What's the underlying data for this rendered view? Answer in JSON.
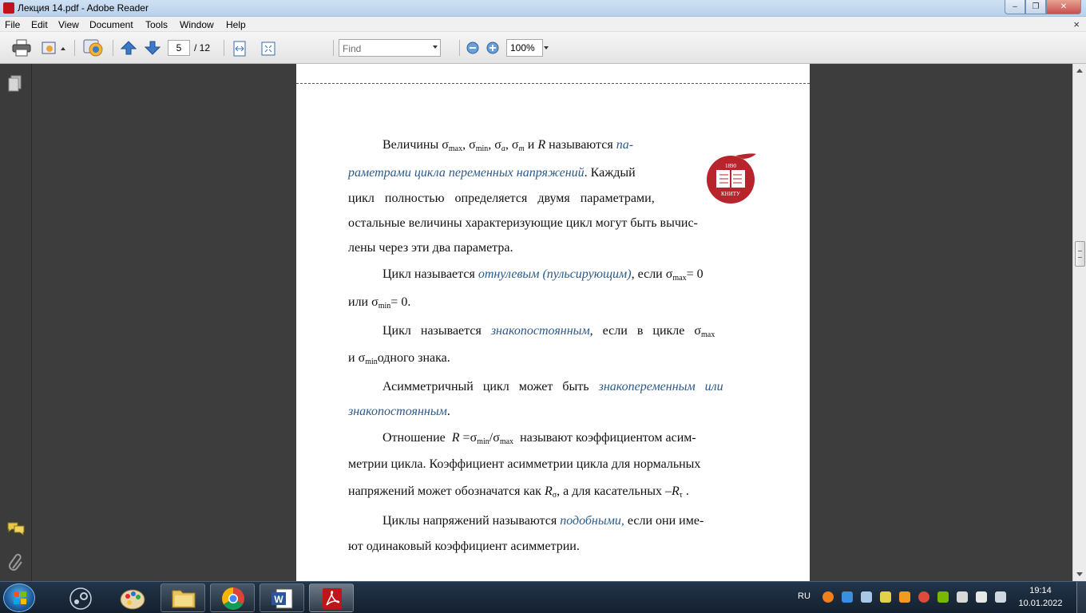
{
  "window": {
    "title": "Лекция 14.pdf - Adobe Reader",
    "minimize": "–",
    "maximize": "❐",
    "close": "✕"
  },
  "menu": {
    "items": [
      "File",
      "Edit",
      "View",
      "Document",
      "Tools",
      "Window",
      "Help"
    ],
    "close_doc": "×"
  },
  "toolbar": {
    "page_current": "5",
    "page_total": "/ 12",
    "find_placeholder": "Find",
    "zoom": "100%"
  },
  "document": {
    "p1": {
      "l1_pre": "Величины",
      "l1_and": "и",
      "l1_R": "R",
      "l1_mid": "называются",
      "l1_term": "па-",
      "l2_term": "раметрами цикла переменных напряжений",
      "l2_post": ". Каждый",
      "l3": "цикл полностью определяется двумя параметрами,",
      "l4": "остальные величины характеризующие цикл могут быть вычис-",
      "l5": "лены через эти два параметра."
    },
    "p2": {
      "pre": "Цикл называется",
      "term": "отнулевым (пульсирующим)",
      "post": ", если",
      "eq": "= 0",
      "l2_pre": "или",
      "l2_eq": "= 0."
    },
    "p3": {
      "pre": "Цикл называется",
      "term": "знакопостоянным",
      "post": ", если в цикле",
      "l2_pre": "и",
      "l2_post": "одного знака."
    },
    "p4": {
      "pre": "Асимметричный цикл может быть",
      "term1": "знакопеременным или",
      "term2": "знакопостоянным",
      "post": "."
    },
    "p5": {
      "pre": "Отношение",
      "formula_R": "R",
      "formula_eq": "=",
      "post": "называют коэффициентом асим-",
      "l2": "метрии цикла. Коэффициент асимметрии цикла для нормальных",
      "l3_pre": "напряжений может обозначатся как",
      "l3_mid": ", а для касательных –",
      "l3_end": "."
    },
    "p6": {
      "pre": "Циклы напряжений называются",
      "term": "подобными,",
      "post": "если они име-",
      "l2": "ют одинаковый коэффициент асимметрии."
    },
    "symbols": {
      "sigma": "σ",
      "tau": "τ",
      "max": "max",
      "min": "min",
      "a": "a",
      "m": "m",
      "slash": "/"
    },
    "logo": {
      "year": "1890",
      "name": "КНИТУ",
      "color": "#b8242c"
    }
  },
  "taskbar": {
    "lang": "RU",
    "time": "19:14",
    "date": "10.01.2022"
  },
  "colors": {
    "term_text": "#2c5a88",
    "doc_bg": "#3d3d3d",
    "pdf_red": "#c0141a"
  }
}
